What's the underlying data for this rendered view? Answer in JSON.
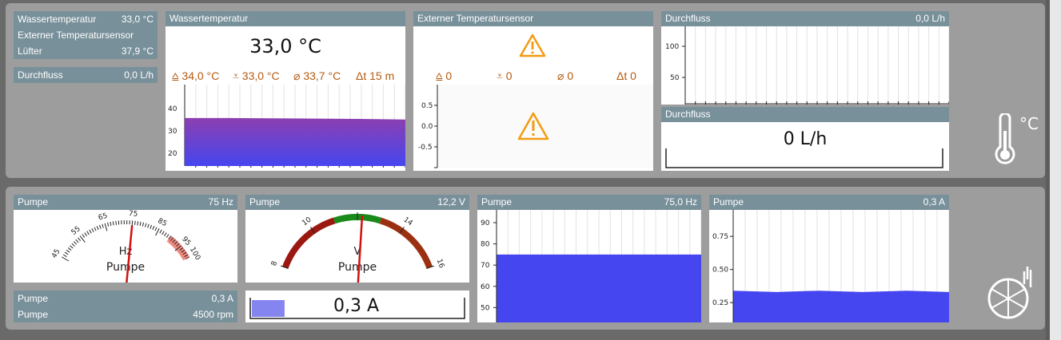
{
  "top": {
    "info": {
      "wasser_label": "Wassertemperatur",
      "wasser_value": "33,0 °C",
      "extern_label": "Externer Temperatursensor",
      "luefter_label": "Lüfter",
      "luefter_value": "37,9 °C",
      "durch_label": "Durchfluss",
      "durch_value": "0,0 L/h"
    },
    "wasser_card": {
      "title": "Wassertemperatur",
      "value": "33,0 °C",
      "max": "34,0 °C",
      "min": "33,0 °C",
      "avg": "33,7 °C",
      "time": "15 m",
      "y_ticks": [
        "40",
        "30",
        "20"
      ],
      "chart_data": {
        "type": "area",
        "series": [
          {
            "values": [
              33.5,
              33.5,
              33.4,
              33.3,
              33.2,
              33.0
            ]
          }
        ],
        "ylim": [
          17,
          45
        ]
      }
    },
    "extern_card": {
      "title": "Externer Temperatursensor",
      "max": "0",
      "min": "0",
      "avg": "0",
      "time": "0",
      "y_ticks": [
        "0.5",
        "0.0",
        "-0.5"
      ]
    },
    "durch_chart": {
      "title": "Durchfluss",
      "value": "0,0 L/h",
      "y_ticks": [
        "100",
        "50"
      ]
    },
    "durch_card": {
      "title": "Durchfluss",
      "value": "0 L/h"
    },
    "temp_unit": "°C"
  },
  "bottom": {
    "hz_gauge": {
      "title": "Pumpe",
      "value": "75 Hz",
      "unit": "Hz",
      "sub": "Pumpe",
      "ticks": [
        "45",
        "55",
        "65",
        "75",
        "85",
        "95",
        "100"
      ],
      "needle": 75
    },
    "v_gauge": {
      "title": "Pumpe",
      "value": "12,2 V",
      "unit": "V",
      "sub": "Pumpe",
      "ticks": [
        "8",
        "10",
        "12",
        "14",
        "16"
      ],
      "needle": 12.2
    },
    "info": {
      "a_label": "Pumpe",
      "a_value": "0,3 A",
      "rpm_label": "Pumpe",
      "rpm_value": "4500 rpm"
    },
    "a_bar": {
      "value": "0,3 A",
      "fill_fraction": 0.4
    },
    "hz_chart": {
      "title": "Pumpe",
      "value": "75,0 Hz",
      "y_ticks": [
        "90",
        "80",
        "70",
        "60",
        "50"
      ],
      "chart_data": {
        "type": "area",
        "series": [
          {
            "values": [
              75,
              75,
              75,
              75,
              75,
              75
            ]
          }
        ],
        "ylim": [
          43,
          96
        ]
      }
    },
    "a_chart": {
      "title": "Pumpe",
      "value": "0,3 A",
      "y_ticks": [
        "0.75",
        "0.50",
        "0.25"
      ],
      "chart_data": {
        "type": "area",
        "series": [
          {
            "values": [
              0.34,
              0.33,
              0.34,
              0.33,
              0.34,
              0.33
            ]
          }
        ],
        "ylim": [
          0.1,
          0.95
        ]
      }
    }
  },
  "colors": {
    "header": "#78909a",
    "accent_purple": "#8a46c8",
    "accent_blue": "#4646f0",
    "warn": "#f39c12"
  }
}
